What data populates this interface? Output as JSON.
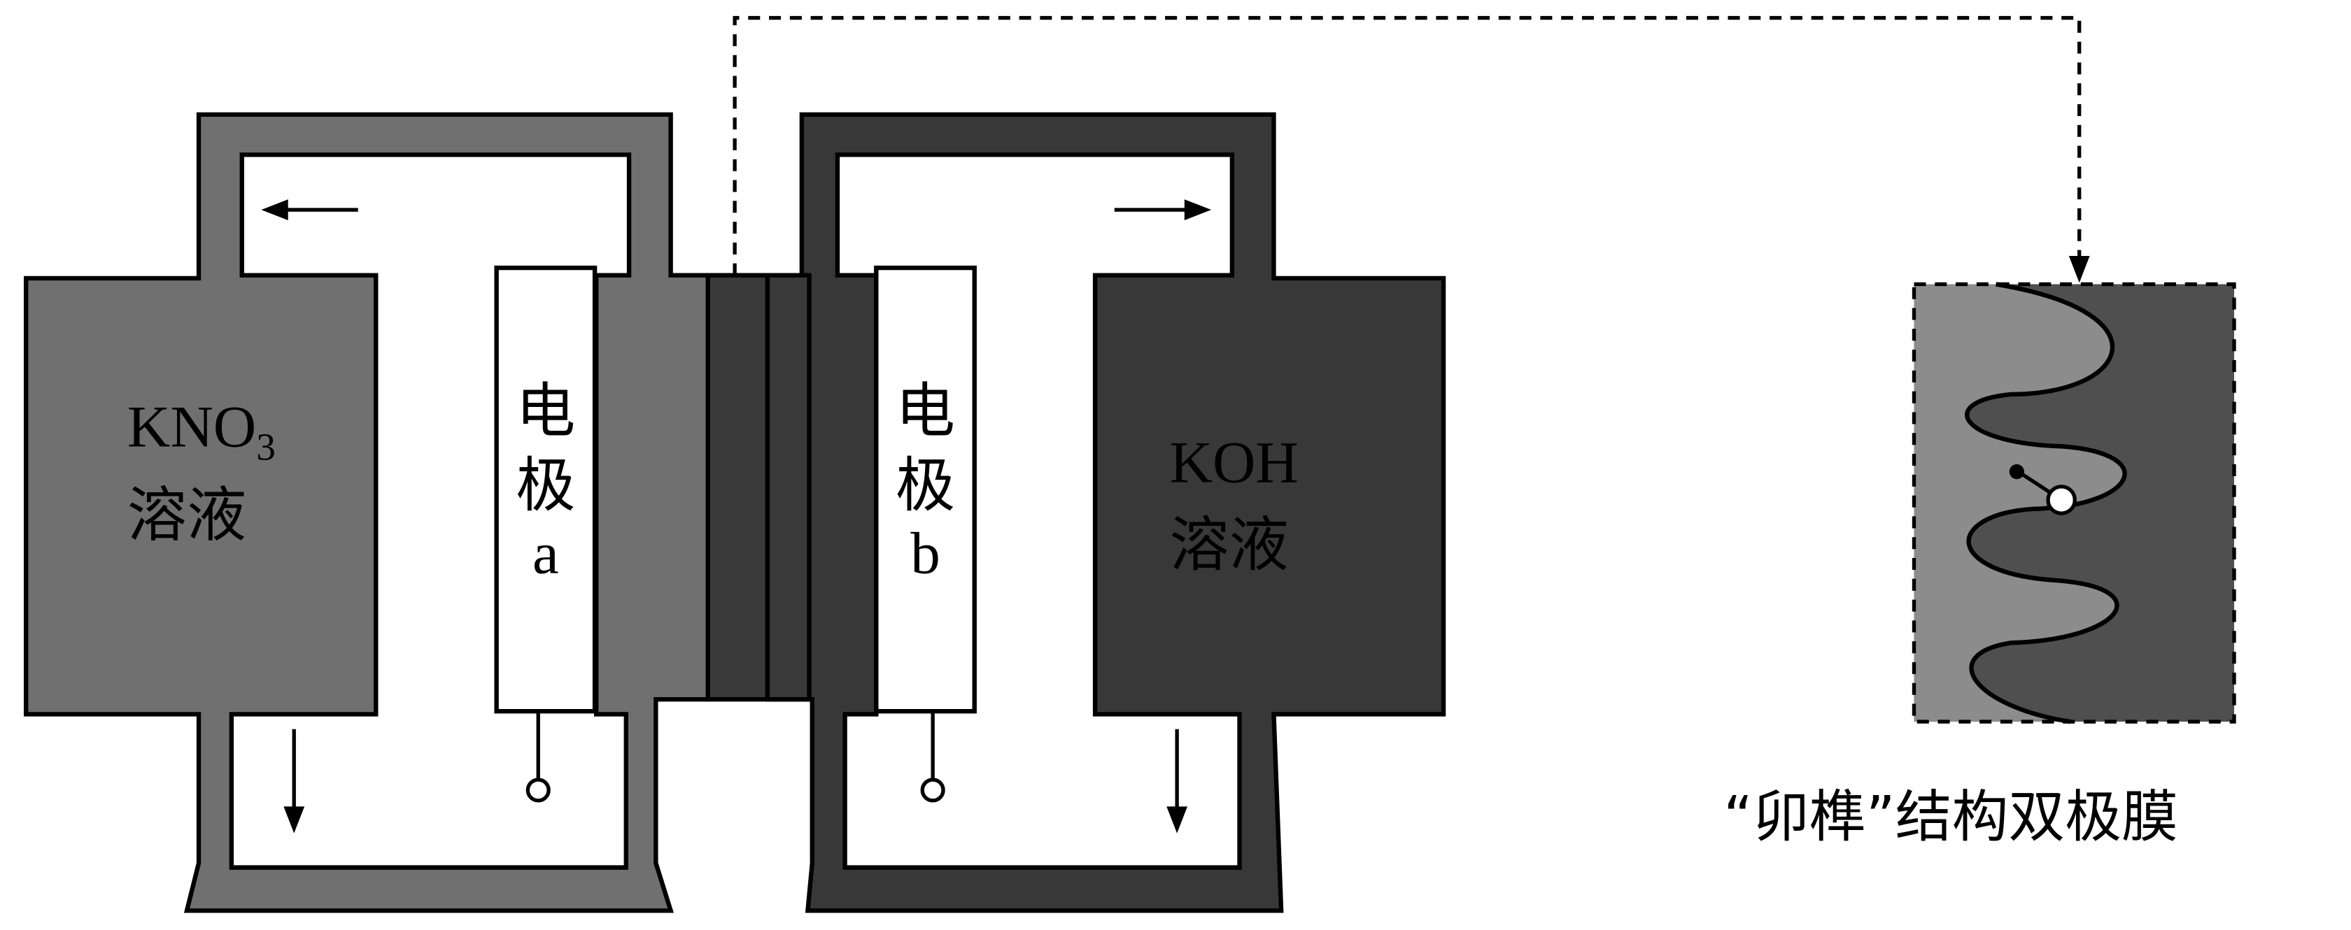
{
  "labels": {
    "left_solution_formula": "KNO",
    "left_solution_subscript": "3",
    "left_solution_word": "溶液",
    "electrode_a_char1": "电",
    "electrode_a_char2": "极",
    "electrode_a_letter": "a",
    "electrode_b_char1": "电",
    "electrode_b_char2": "极",
    "electrode_b_letter": "b",
    "right_solution_formula": "KOH",
    "right_solution_word": "溶液",
    "membrane_caption": "“卯榫”结构双极膜"
  },
  "colors": {
    "left_chamber": "#707070",
    "right_chamber": "#383838",
    "membrane_left_half": "#8c8c8c",
    "membrane_right_half": "#4a4a4a",
    "electrode_fill": "#ffffff",
    "outline": "#000000"
  }
}
